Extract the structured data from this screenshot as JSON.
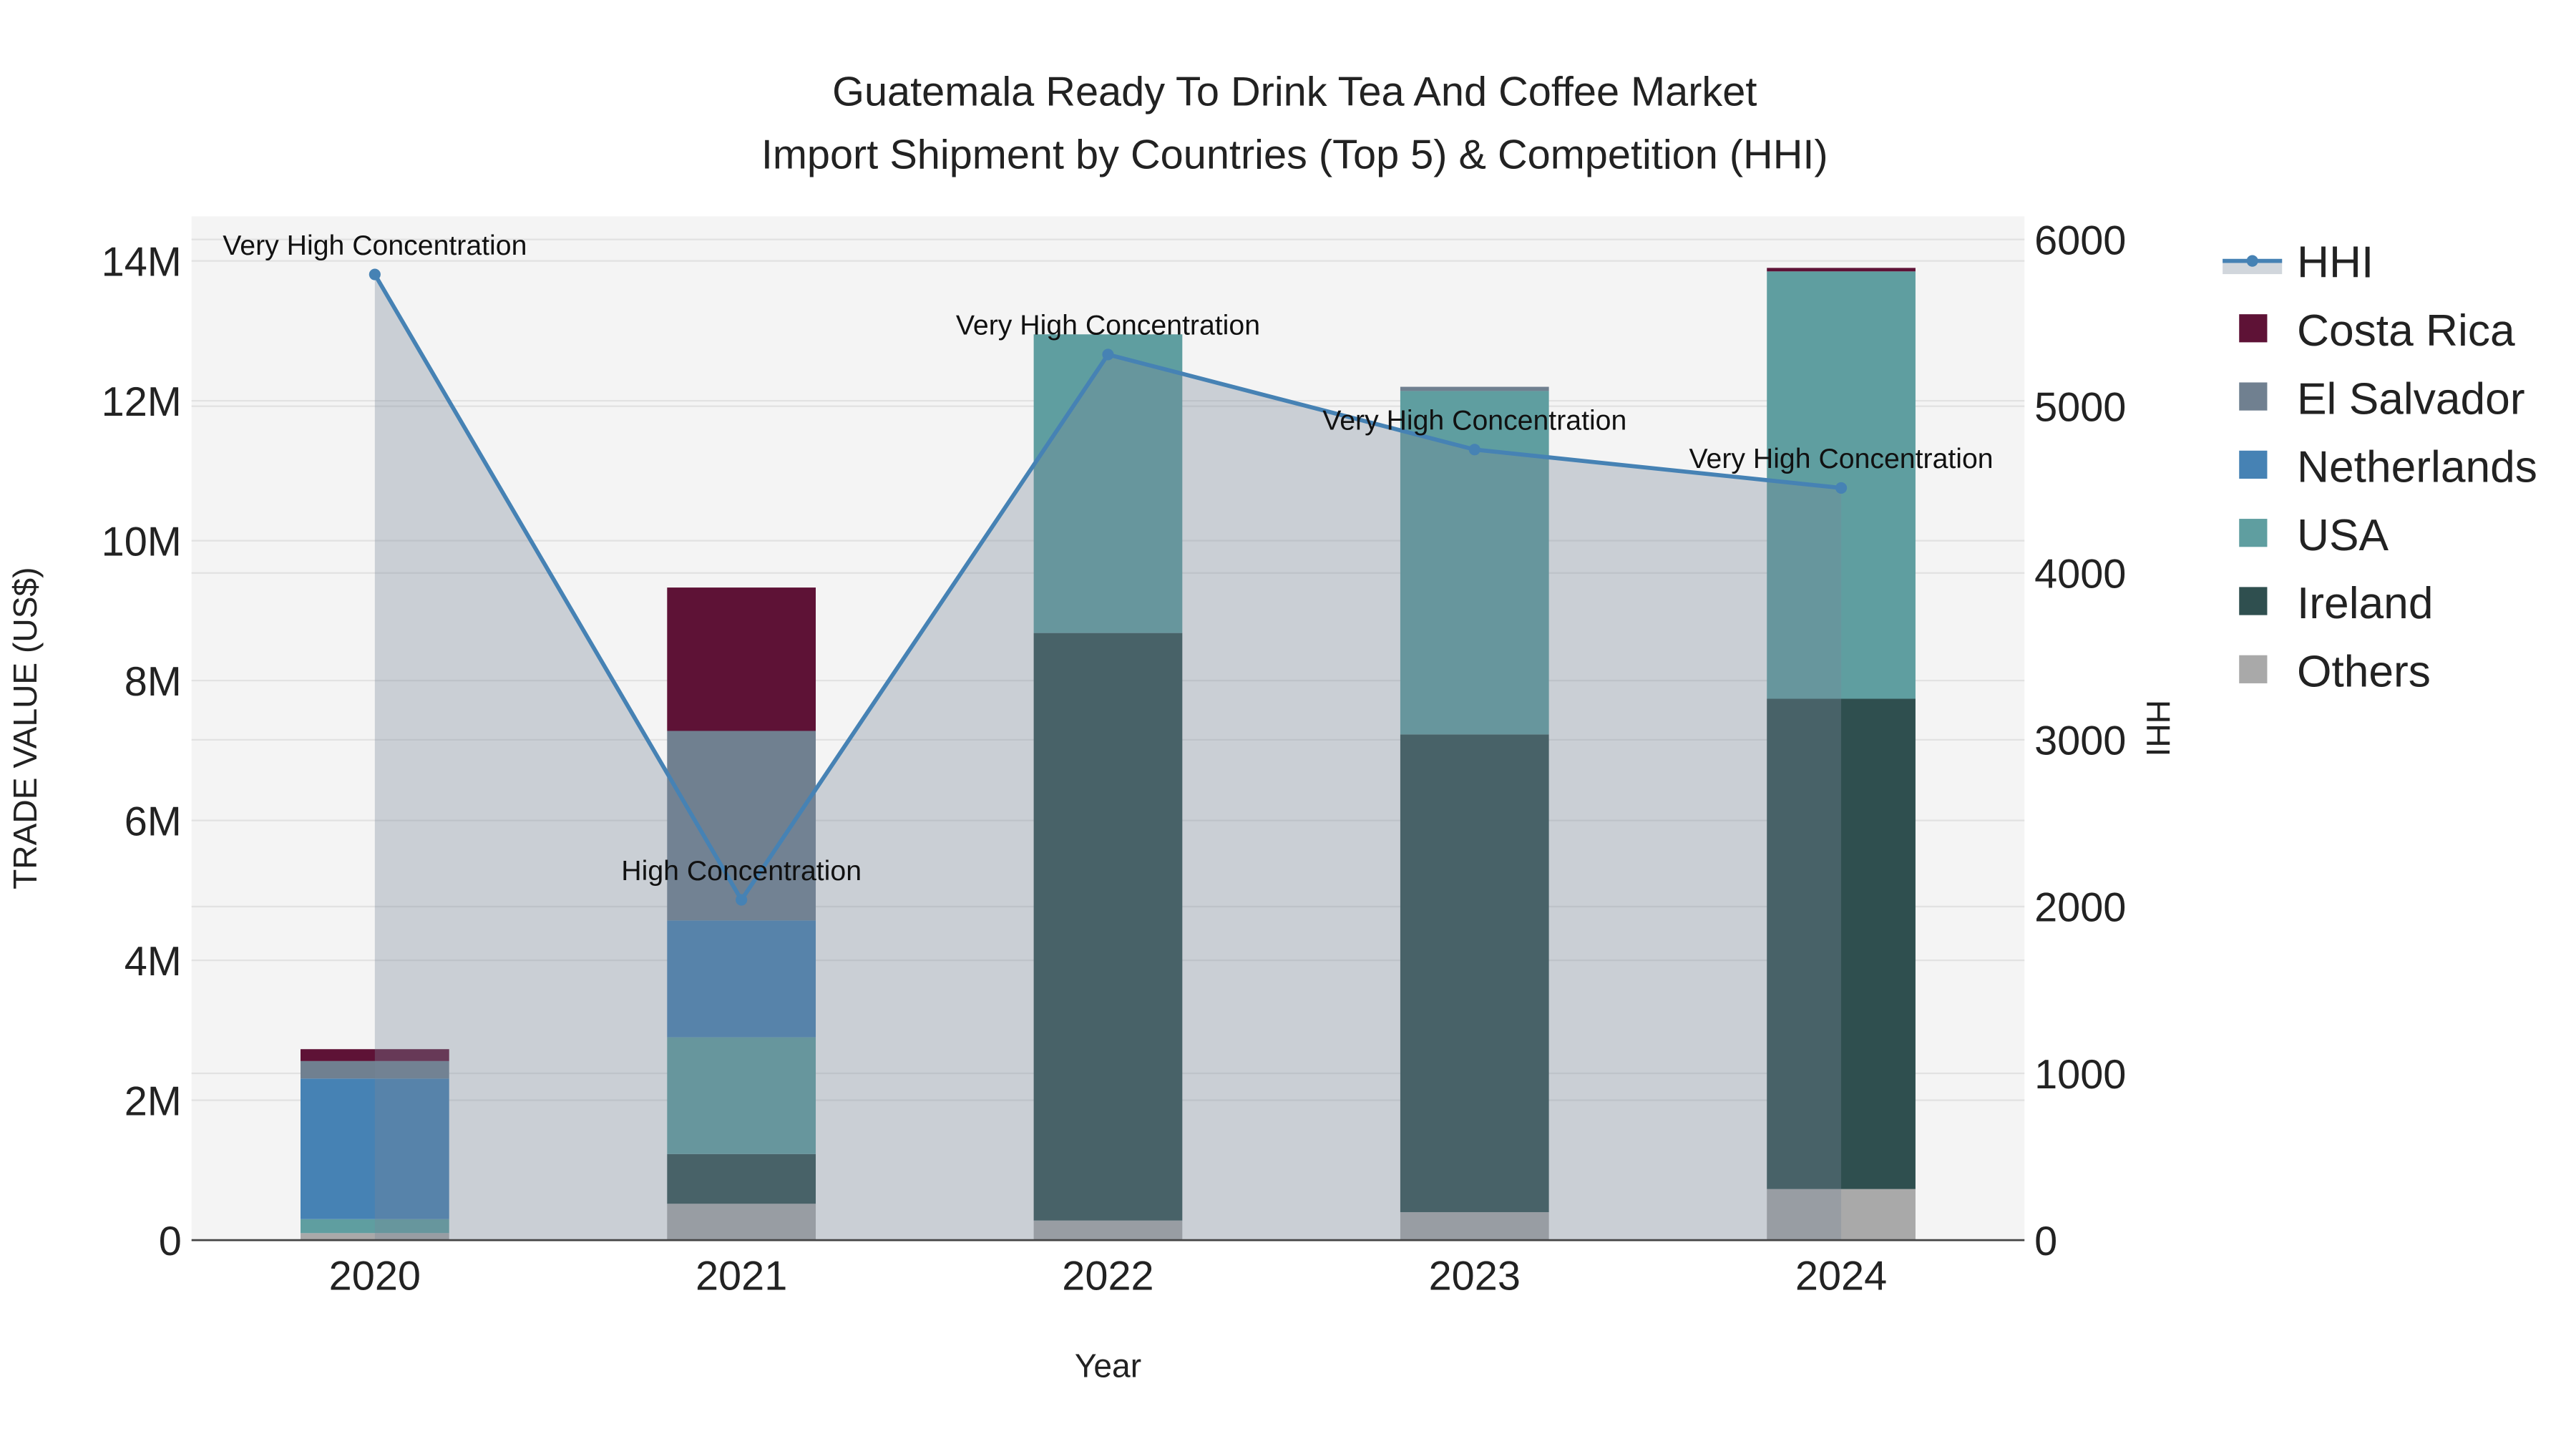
{
  "chart_data": {
    "type": "bar",
    "title": "Guatemala Ready To Drink Tea And Coffee Market",
    "subtitle": "Import Shipment by Countries (Top 5) & Competition (HHI)",
    "xlabel": "Year",
    "ylabel": "TRADE VALUE (US$)",
    "y2label": "HHI",
    "categories": [
      "2020",
      "2021",
      "2022",
      "2023",
      "2024"
    ],
    "ylim": [
      0,
      14500000
    ],
    "y2lim": [
      0,
      6100
    ],
    "yticks": [
      0,
      2000000,
      4000000,
      6000000,
      8000000,
      10000000,
      12000000,
      14000000
    ],
    "ytick_labels": [
      "0",
      "2M",
      "4M",
      "6M",
      "8M",
      "10M",
      "12M",
      "14M"
    ],
    "y2ticks": [
      0,
      1000,
      2000,
      3000,
      4000,
      5000,
      6000
    ],
    "y2tick_labels": [
      "0",
      "1000",
      "2000",
      "3000",
      "4000",
      "5000",
      "6000"
    ],
    "grid": true,
    "legend_placement": "right",
    "series": [
      {
        "name": "Others",
        "color": "#a9a9a9",
        "values": [
          100000,
          520000,
          280000,
          400000,
          730000
        ]
      },
      {
        "name": "Ireland",
        "color": "#2f4f4f",
        "values": [
          0,
          710000,
          8400000,
          6830000,
          7010000
        ]
      },
      {
        "name": "USA",
        "color": "#5f9ea0",
        "values": [
          200000,
          1670000,
          4270000,
          4910000,
          6110000
        ]
      },
      {
        "name": "Netherlands",
        "color": "#4682b4",
        "values": [
          2010000,
          1670000,
          0,
          0,
          0
        ]
      },
      {
        "name": "El Salvador",
        "color": "#708090",
        "values": [
          250000,
          2710000,
          0,
          60000,
          0
        ]
      },
      {
        "name": "Costa Rica",
        "color": "#5e1236",
        "values": [
          170000,
          2050000,
          0,
          0,
          50000
        ]
      }
    ],
    "hhi": {
      "name": "HHI",
      "color": "#4682b4",
      "values": [
        5790,
        2040,
        5310,
        4740,
        4510
      ],
      "annotations": [
        "Very High Concentration",
        "High Concentration",
        "Very High Concentration",
        "Very High Concentration",
        "Very High Concentration"
      ]
    },
    "legend_order": [
      "HHI",
      "Costa Rica",
      "El Salvador",
      "Netherlands",
      "USA",
      "Ireland",
      "Others"
    ]
  }
}
